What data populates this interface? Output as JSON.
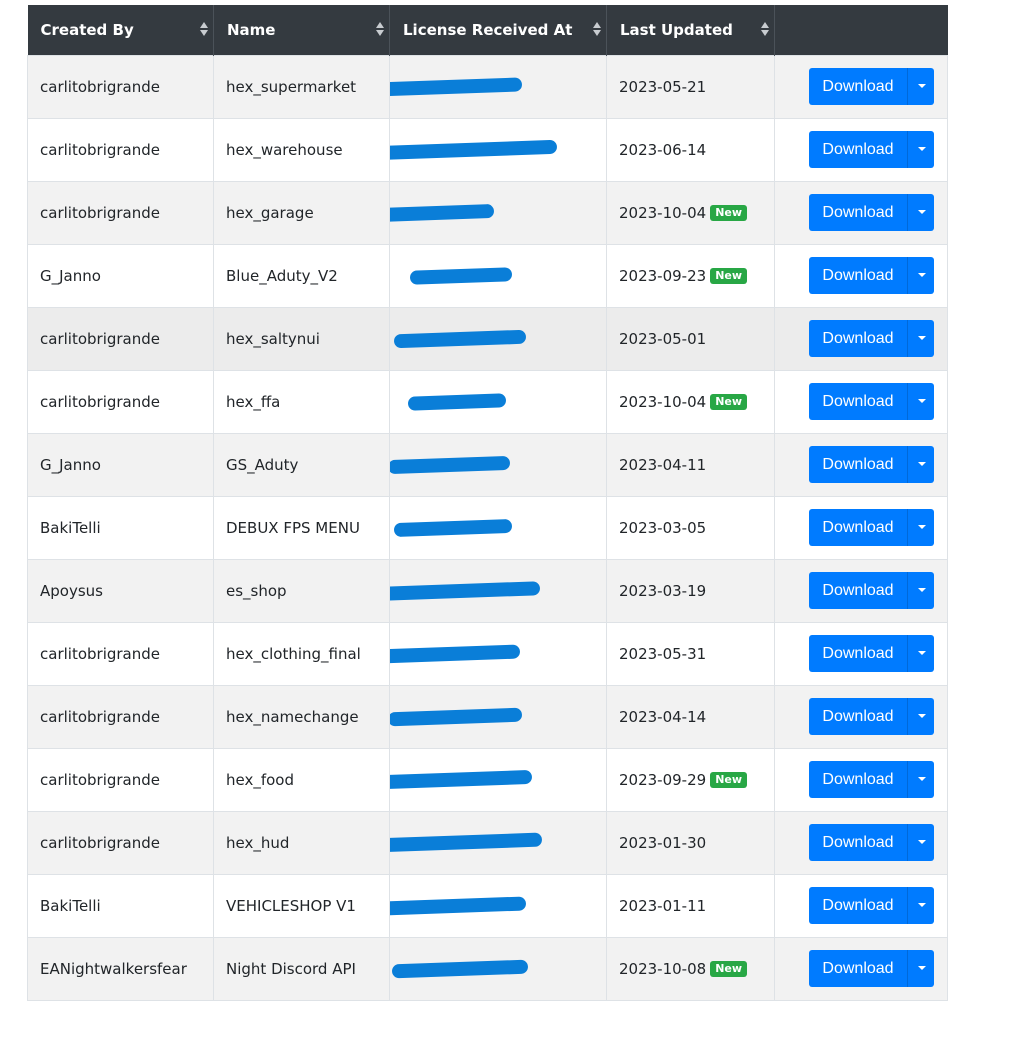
{
  "table": {
    "headers": [
      "Created By",
      "Name",
      "License Received At",
      "Last Updated",
      ""
    ],
    "new_badge_label": "New",
    "download_label": "Download",
    "accent_color": "#007bff",
    "badge_color": "#28a745",
    "redaction_color": "#0a7ed8",
    "rows": [
      {
        "created_by": "carlitobrigrande",
        "name": "hex_supermarket",
        "license": "[redacted]",
        "updated": "2023-05-21",
        "new": false
      },
      {
        "created_by": "carlitobrigrande",
        "name": "hex_warehouse",
        "license": "[redacted]",
        "updated": "2023-06-14",
        "new": false
      },
      {
        "created_by": "carlitobrigrande",
        "name": "hex_garage",
        "license": "[redacted]",
        "updated": "2023-10-04",
        "new": true
      },
      {
        "created_by": "G_Janno",
        "name": "Blue_Aduty_V2",
        "license": "[redacted]",
        "updated": "2023-09-23",
        "new": true
      },
      {
        "created_by": "carlitobrigrande",
        "name": "hex_saltynui",
        "license": "[redacted]",
        "updated": "2023-05-01",
        "new": false
      },
      {
        "created_by": "carlitobrigrande",
        "name": "hex_ffa",
        "license": "[redacted]",
        "updated": "2023-10-04",
        "new": true
      },
      {
        "created_by": "G_Janno",
        "name": "GS_Aduty",
        "license": "[redacted]",
        "updated": "2023-04-11",
        "new": false
      },
      {
        "created_by": "BakiTelli",
        "name": "DEBUX FPS MENU",
        "license": "[redacted]",
        "updated": "2023-03-05",
        "new": false
      },
      {
        "created_by": "Apoysus",
        "name": "es_shop",
        "license": "[redacted]",
        "updated": "2023-03-19",
        "new": false
      },
      {
        "created_by": "carlitobrigrande",
        "name": "hex_clothing_final",
        "license": "[redacted]",
        "updated": "2023-05-31",
        "new": false
      },
      {
        "created_by": "carlitobrigrande",
        "name": "hex_namechange",
        "license": "[redacted]",
        "updated": "2023-04-14",
        "new": false
      },
      {
        "created_by": "carlitobrigrande",
        "name": "hex_food",
        "license": "[redacted]",
        "updated": "2023-09-29",
        "new": true
      },
      {
        "created_by": "carlitobrigrande",
        "name": "hex_hud",
        "license": "[redacted]",
        "updated": "2023-01-30",
        "new": false
      },
      {
        "created_by": "BakiTelli",
        "name": "VEHICLESHOP V1",
        "license": "[redacted]",
        "updated": "2023-01-11",
        "new": false
      },
      {
        "created_by": "EANightwalkersfear",
        "name": "Night Discord API",
        "license": "[redacted]",
        "updated": "2023-10-08",
        "new": true
      }
    ]
  }
}
